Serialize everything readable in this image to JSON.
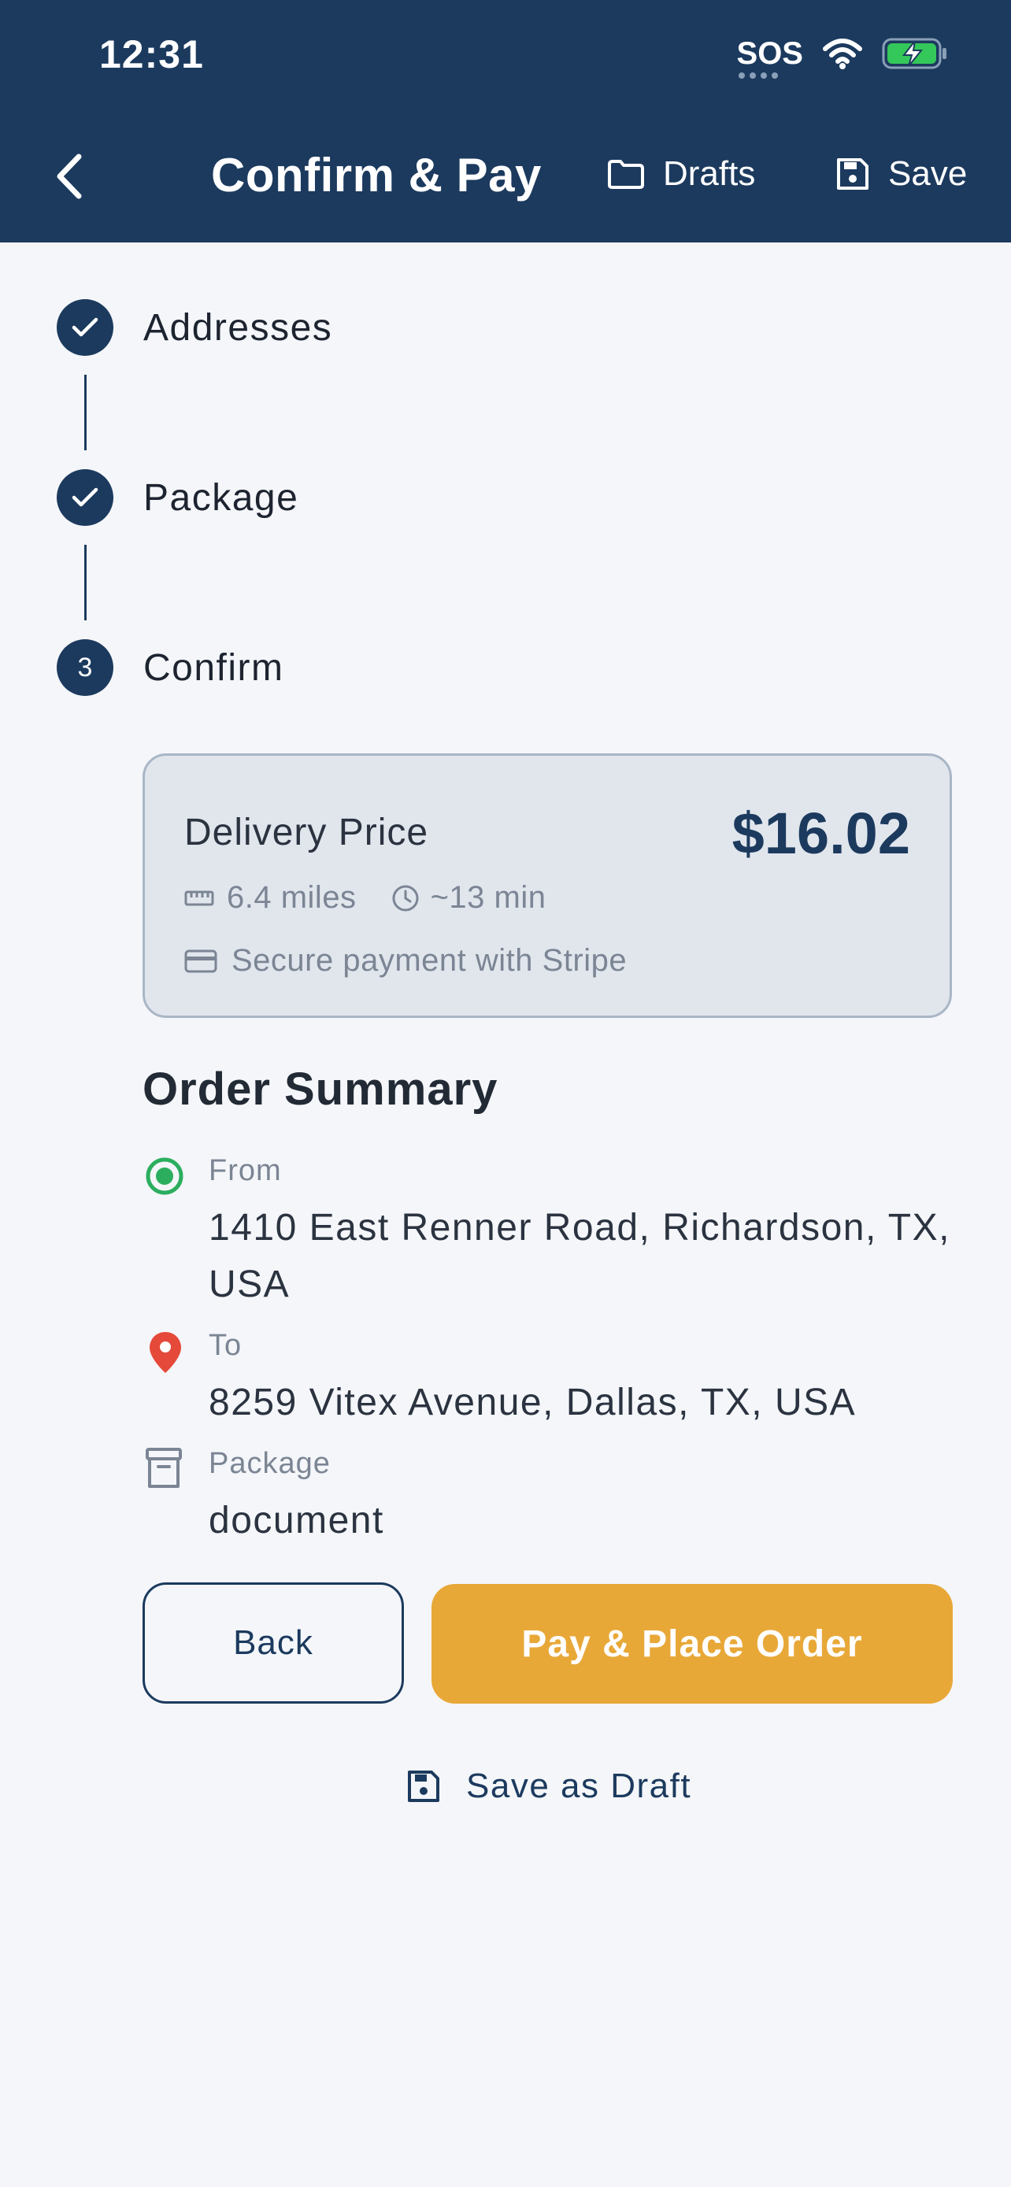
{
  "status_bar": {
    "time": "12:31",
    "sos": "SOS"
  },
  "header": {
    "title": "Confirm & Pay",
    "drafts_label": "Drafts",
    "save_label": "Save"
  },
  "stepper": {
    "steps": [
      {
        "label": "Addresses",
        "state": "complete"
      },
      {
        "label": "Package",
        "state": "complete"
      },
      {
        "label": "Confirm",
        "state": "current",
        "number": "3"
      }
    ]
  },
  "price_card": {
    "label": "Delivery Price",
    "price": "$16.02",
    "distance": "6.4 miles",
    "duration": "~13 min",
    "payment_note": "Secure payment with Stripe"
  },
  "summary": {
    "title": "Order Summary",
    "from_label": "From",
    "from_value": "1410 East Renner Road, Richardson, TX, USA",
    "to_label": "To",
    "to_value": "8259 Vitex Avenue, Dallas, TX, USA",
    "package_label": "Package",
    "package_value": "document"
  },
  "actions": {
    "back_label": "Back",
    "pay_label": "Pay & Place Order",
    "save_draft_label": "Save as Draft"
  },
  "colors": {
    "primary": "#1c3a5e",
    "accent": "#e8a838",
    "from_marker": "#2bae5e",
    "to_marker": "#e5493a"
  },
  "icons": {
    "back": "chevron-left-icon",
    "drafts": "folder-icon",
    "save": "floppy-disk-icon",
    "distance": "ruler-icon",
    "duration": "clock-icon",
    "payment": "credit-card-icon",
    "from": "radio-dot-icon",
    "to": "map-pin-icon",
    "package": "archive-box-icon"
  }
}
